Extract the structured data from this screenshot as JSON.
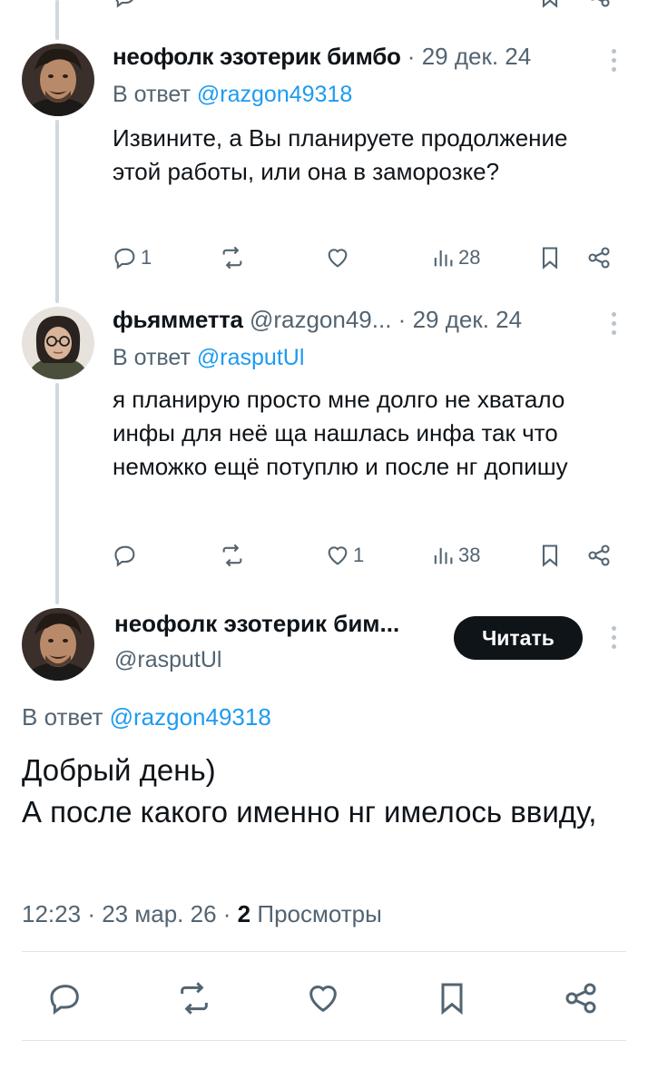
{
  "colors": {
    "accent": "#1d9bf0",
    "text": "#0f1419",
    "muted": "#536471",
    "thread_line": "#cfd9de"
  },
  "reply1": {
    "name": "неофолк эзотерик бимбо",
    "separator": "·",
    "date": "29 дек. 24",
    "reply_prefix": "В ответ",
    "reply_mention": "@razgon49318",
    "text": "Извините, а Вы планируете продолжение этой работы, или она в заморозке?",
    "replies": "1",
    "reposts": "",
    "likes": "",
    "views": "28",
    "icons": [
      "reply-icon",
      "repost-icon",
      "like-icon",
      "views-icon",
      "bookmark-icon",
      "share-icon"
    ]
  },
  "reply2": {
    "name": "фьямметта",
    "handle": "@razgon49...",
    "separator": "·",
    "date": "29 дек. 24",
    "reply_prefix": "В ответ",
    "reply_mention": "@rasputUl",
    "text": "я планирую просто мне долго не хватало инфы для неё ща нашлась инфа так что неможко ещё потуплю и после нг допишу",
    "replies": "",
    "reposts": "",
    "likes": "1",
    "views": "38"
  },
  "main_tweet": {
    "name": "неофолк эзотерик бим...",
    "handle": "@rasputUl",
    "follow_label": "Читать",
    "reply_prefix": "В ответ",
    "reply_mention": "@razgon49318",
    "text_line1": "Добрый день)",
    "text_line2": "А после какого именно нг имелось ввиду,",
    "time": "12:23",
    "separator": "·",
    "date": "23 мар. 26",
    "views_count": "2",
    "views_label": "Просмотры"
  }
}
